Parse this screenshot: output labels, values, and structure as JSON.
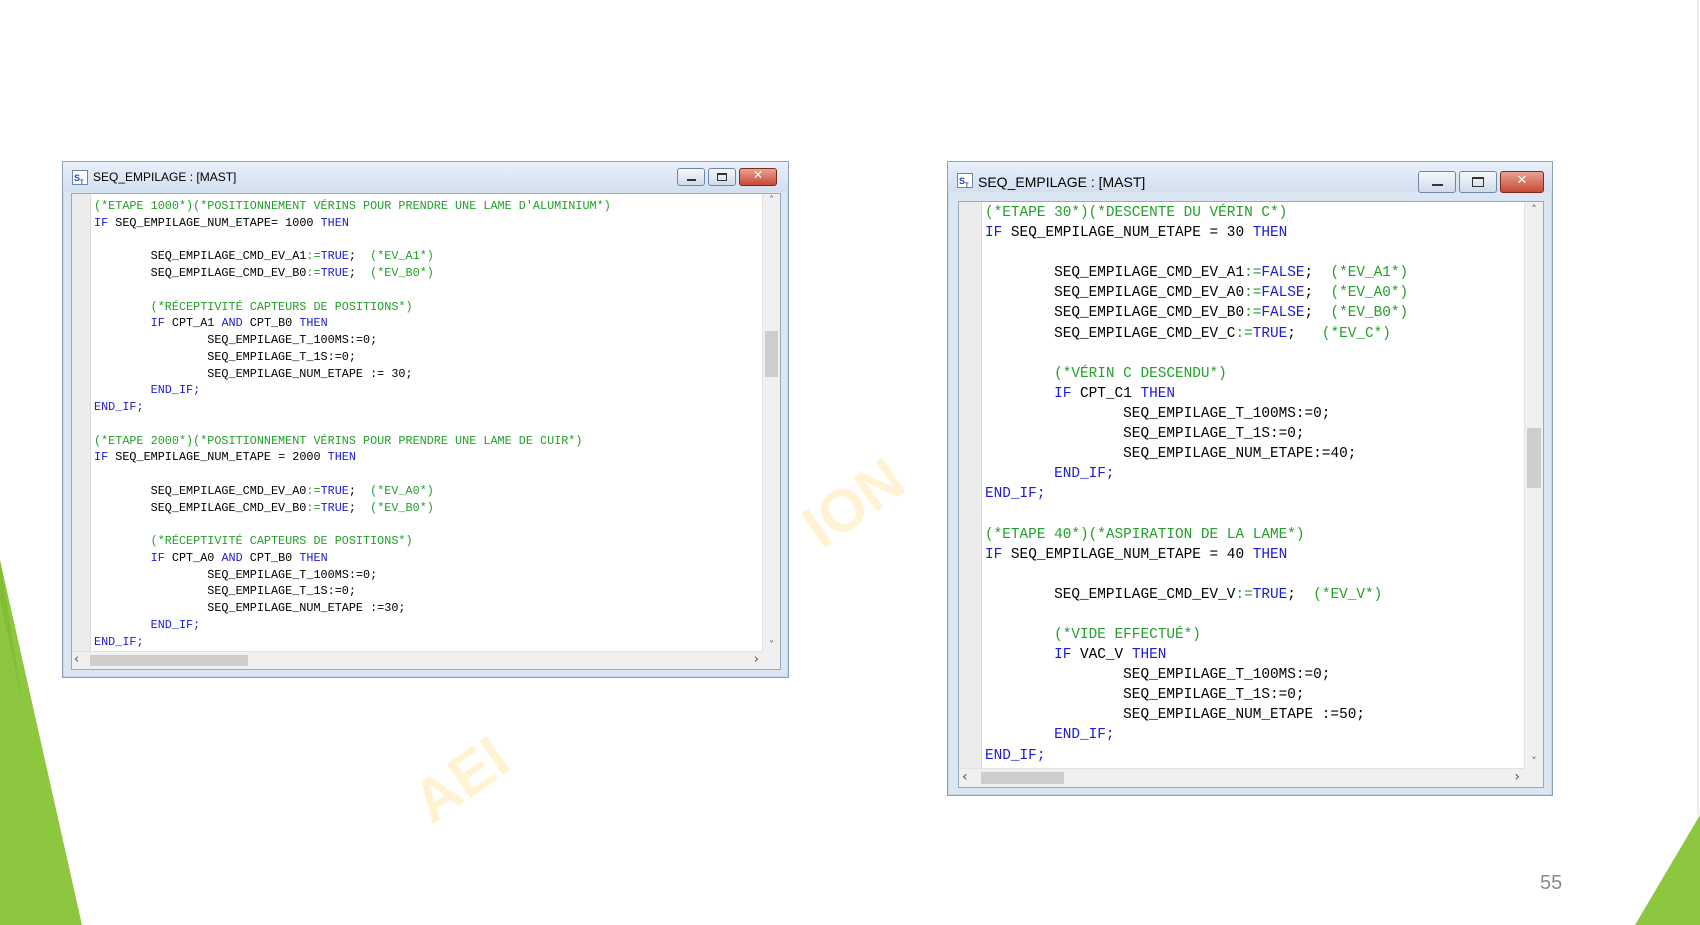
{
  "slide": {
    "number": "55"
  },
  "watermark": {
    "left_text": "AEI",
    "right_text": "ION"
  },
  "colors": {
    "accent_green": "#8dc63f",
    "comment_green": "#22a02a",
    "keyword_blue": "#1b1bd8",
    "window_frame": "#dbe6f3"
  },
  "windows": [
    {
      "title": "SEQ_EMPILAGE : [MAST]",
      "icon": "st-editor-icon",
      "lines": [
        [
          [
            "(*ETAPE 1000*)(*POSITIONNEMENT VÉRINS POUR PRENDRE UNE LAME D'ALUMINIUM*)",
            "cm"
          ]
        ],
        [
          [
            "IF",
            "kw"
          ],
          [
            " SEQ_EMPILAGE_NUM_ETAPE",
            ""
          ],
          [
            "=",
            ""
          ],
          [
            " 1000 ",
            ""
          ],
          [
            "THEN",
            "kw"
          ]
        ],
        [],
        [
          [
            "        SEQ_EMPILAGE_CMD_EV_A1",
            ""
          ],
          [
            ":=",
            "cm"
          ],
          [
            "TRUE",
            "kw"
          ],
          [
            ";  ",
            ""
          ],
          [
            "(*EV_A1*)",
            "cm"
          ]
        ],
        [
          [
            "        SEQ_EMPILAGE_CMD_EV_B0",
            ""
          ],
          [
            ":=",
            "cm"
          ],
          [
            "TRUE",
            "kw"
          ],
          [
            ";  ",
            ""
          ],
          [
            "(*EV_B0*)",
            "cm"
          ]
        ],
        [],
        [
          [
            "        (*RÉCEPTIVITÉ CAPTEURS DE POSITIONS*)",
            "cm"
          ]
        ],
        [
          [
            "        ",
            ""
          ],
          [
            "IF",
            "kw"
          ],
          [
            " CPT_A1 ",
            ""
          ],
          [
            "AND",
            "kw"
          ],
          [
            " CPT_B0 ",
            ""
          ],
          [
            "THEN",
            "kw"
          ]
        ],
        [
          [
            "                SEQ_EMPILAGE_T_100MS",
            ""
          ],
          [
            ":=",
            ""
          ],
          [
            "0;",
            ""
          ]
        ],
        [
          [
            "                SEQ_EMPILAGE_T_1S",
            ""
          ],
          [
            ":=",
            ""
          ],
          [
            "0;",
            ""
          ]
        ],
        [
          [
            "                SEQ_EMPILAGE_NUM_ETAPE ",
            ""
          ],
          [
            ":=",
            ""
          ],
          [
            " 30;",
            ""
          ]
        ],
        [
          [
            "        ",
            ""
          ],
          [
            "END_IF;",
            "kw"
          ]
        ],
        [
          [
            "END_IF;",
            "kw"
          ]
        ],
        [],
        [
          [
            "(*ETAPE 2000*)(*POSITIONNEMENT VÉRINS POUR PRENDRE UNE LAME DE CUIR*)",
            "cm"
          ]
        ],
        [
          [
            "IF",
            "kw"
          ],
          [
            " SEQ_EMPILAGE_NUM_ETAPE = 2000 ",
            ""
          ],
          [
            "THEN",
            "kw"
          ]
        ],
        [],
        [
          [
            "        SEQ_EMPILAGE_CMD_EV_A0",
            ""
          ],
          [
            ":=",
            "cm"
          ],
          [
            "TRUE",
            "kw"
          ],
          [
            ";  ",
            ""
          ],
          [
            "(*EV_A0*)",
            "cm"
          ]
        ],
        [
          [
            "        SEQ_EMPILAGE_CMD_EV_B0",
            ""
          ],
          [
            ":=",
            "cm"
          ],
          [
            "TRUE",
            "kw"
          ],
          [
            ";  ",
            ""
          ],
          [
            "(*EV_B0*)",
            "cm"
          ]
        ],
        [],
        [
          [
            "        (*RÉCEPTIVITÉ CAPTEURS DE POSITIONS*)",
            "cm"
          ]
        ],
        [
          [
            "        ",
            ""
          ],
          [
            "IF",
            "kw"
          ],
          [
            " CPT_A0 ",
            ""
          ],
          [
            "AND",
            "kw"
          ],
          [
            " CPT_B0 ",
            ""
          ],
          [
            "THEN",
            "kw"
          ]
        ],
        [
          [
            "                SEQ_EMPILAGE_T_100MS",
            ""
          ],
          [
            ":=",
            ""
          ],
          [
            "0;",
            ""
          ]
        ],
        [
          [
            "                SEQ_EMPILAGE_T_1S",
            ""
          ],
          [
            ":=",
            ""
          ],
          [
            "0;",
            ""
          ]
        ],
        [
          [
            "                SEQ_EMPILAGE_NUM_ETAPE ",
            ""
          ],
          [
            ":=",
            ""
          ],
          [
            "30;",
            ""
          ]
        ],
        [
          [
            "        ",
            ""
          ],
          [
            "END_IF;",
            "kw"
          ]
        ],
        [
          [
            "END_IF;",
            "kw"
          ]
        ]
      ]
    },
    {
      "title": "SEQ_EMPILAGE : [MAST]",
      "icon": "st-editor-icon",
      "lines": [
        [
          [
            "(*ETAPE 30*)(*DESCENTE DU VÉRIN C*)",
            "cm"
          ]
        ],
        [
          [
            "IF",
            "kw"
          ],
          [
            " SEQ_EMPILAGE_NUM_ETAPE = 30 ",
            ""
          ],
          [
            "THEN",
            "kw"
          ]
        ],
        [],
        [
          [
            "        SEQ_EMPILAGE_CMD_EV_A1",
            ""
          ],
          [
            ":=",
            "cm"
          ],
          [
            "FALSE",
            "kw"
          ],
          [
            ";  ",
            ""
          ],
          [
            "(*EV_A1*)",
            "cm"
          ]
        ],
        [
          [
            "        SEQ_EMPILAGE_CMD_EV_A0",
            ""
          ],
          [
            ":=",
            "cm"
          ],
          [
            "FALSE",
            "kw"
          ],
          [
            ";  ",
            ""
          ],
          [
            "(*EV_A0*)",
            "cm"
          ]
        ],
        [
          [
            "        SEQ_EMPILAGE_CMD_EV_B0",
            ""
          ],
          [
            ":=",
            "cm"
          ],
          [
            "FALSE",
            "kw"
          ],
          [
            ";  ",
            ""
          ],
          [
            "(*EV_B0*)",
            "cm"
          ]
        ],
        [
          [
            "        SEQ_EMPILAGE_CMD_EV_C",
            ""
          ],
          [
            ":=",
            "cm"
          ],
          [
            "TRUE",
            "kw"
          ],
          [
            ";   ",
            ""
          ],
          [
            "(*EV_C*)",
            "cm"
          ]
        ],
        [],
        [
          [
            "        (*VÉRIN C DESCENDU*)",
            "cm"
          ]
        ],
        [
          [
            "        ",
            ""
          ],
          [
            "IF",
            "kw"
          ],
          [
            " CPT_C1 ",
            ""
          ],
          [
            "THEN",
            "kw"
          ]
        ],
        [
          [
            "                SEQ_EMPILAGE_T_100MS",
            ""
          ],
          [
            ":=",
            ""
          ],
          [
            "0;",
            ""
          ]
        ],
        [
          [
            "                SEQ_EMPILAGE_T_1S",
            ""
          ],
          [
            ":=",
            ""
          ],
          [
            "0;",
            ""
          ]
        ],
        [
          [
            "                SEQ_EMPILAGE_NUM_ETAPE",
            ""
          ],
          [
            ":=",
            ""
          ],
          [
            "40;",
            ""
          ]
        ],
        [
          [
            "        ",
            ""
          ],
          [
            "END_IF;",
            "kw"
          ]
        ],
        [
          [
            "END_IF;",
            "kw"
          ]
        ],
        [],
        [
          [
            "(*ETAPE 40*)(*ASPIRATION DE LA LAME*)",
            "cm"
          ]
        ],
        [
          [
            "IF",
            "kw"
          ],
          [
            " SEQ_EMPILAGE_NUM_ETAPE = 40 ",
            ""
          ],
          [
            "THEN",
            "kw"
          ]
        ],
        [],
        [
          [
            "        SEQ_EMPILAGE_CMD_EV_V",
            ""
          ],
          [
            ":=",
            "cm"
          ],
          [
            "TRUE",
            "kw"
          ],
          [
            ";  ",
            ""
          ],
          [
            "(*EV_V*)",
            "cm"
          ]
        ],
        [],
        [
          [
            "        (*VIDE EFFECTUÉ*)",
            "cm"
          ]
        ],
        [
          [
            "        ",
            ""
          ],
          [
            "IF",
            "kw"
          ],
          [
            " VAC_V ",
            ""
          ],
          [
            "THEN",
            "kw"
          ]
        ],
        [
          [
            "                SEQ_EMPILAGE_T_100MS",
            ""
          ],
          [
            ":=",
            ""
          ],
          [
            "0;",
            ""
          ]
        ],
        [
          [
            "                SEQ_EMPILAGE_T_1S",
            ""
          ],
          [
            ":=",
            ""
          ],
          [
            "0;",
            ""
          ]
        ],
        [
          [
            "                SEQ_EMPILAGE_NUM_ETAPE ",
            ""
          ],
          [
            ":=",
            ""
          ],
          [
            "50;",
            ""
          ]
        ],
        [
          [
            "        ",
            ""
          ],
          [
            "END_IF;",
            "kw"
          ]
        ],
        [
          [
            "END_IF;",
            "kw"
          ]
        ]
      ]
    }
  ]
}
